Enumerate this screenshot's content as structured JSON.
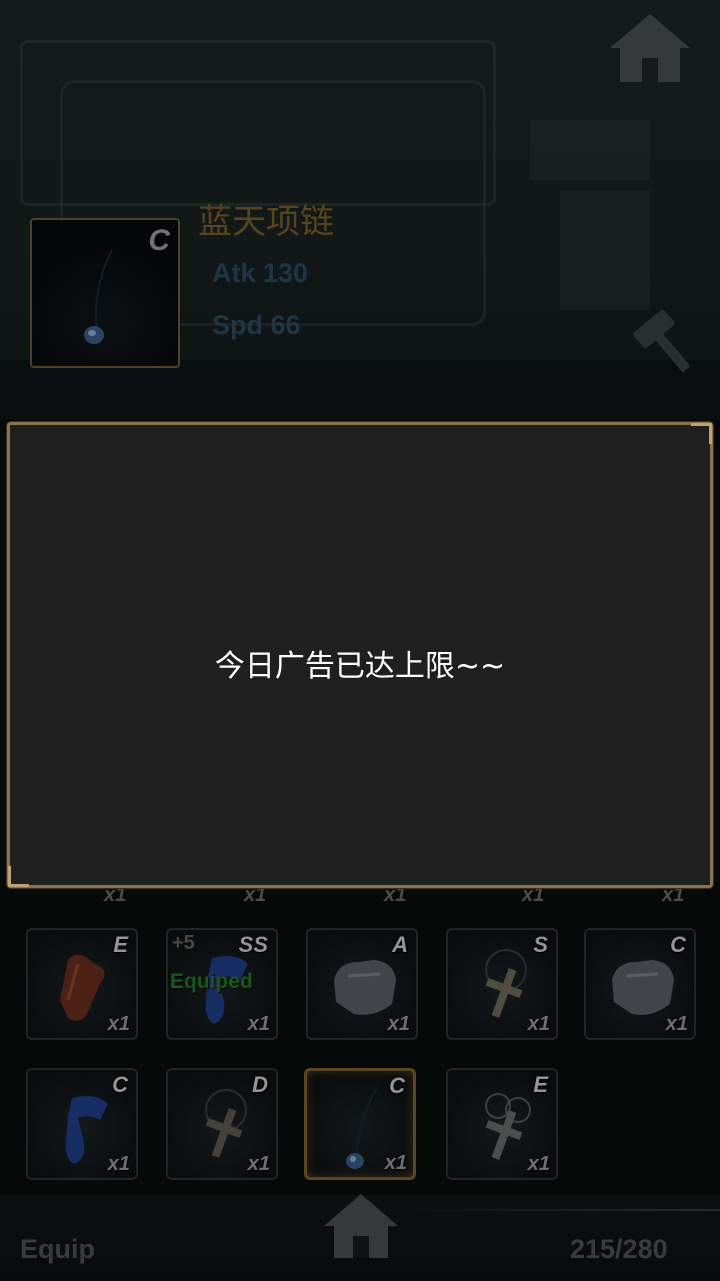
{
  "item_detail": {
    "name": "蓝天项链",
    "grade": "C",
    "stats": [
      "Atk 130",
      "Spd 66"
    ]
  },
  "dialog": {
    "message": "今日广告已达上限~~"
  },
  "partial_row_qty": [
    "x1",
    "x1",
    "x1",
    "x1",
    "x1"
  ],
  "inventory": [
    {
      "grade": "E",
      "qty": "x1",
      "plus": "",
      "equipped": "",
      "icon": "gloves-icon"
    },
    {
      "grade": "SS",
      "qty": "x1",
      "plus": "+5",
      "equipped": "Equiped",
      "icon": "blue-scarf-icon"
    },
    {
      "grade": "A",
      "qty": "x1",
      "plus": "",
      "equipped": "",
      "icon": "armor-icon"
    },
    {
      "grade": "S",
      "qty": "x1",
      "plus": "",
      "equipped": "",
      "icon": "cross-necklace-icon"
    },
    {
      "grade": "C",
      "qty": "x1",
      "plus": "",
      "equipped": "",
      "icon": "armor-icon"
    },
    {
      "grade": "C",
      "qty": "x1",
      "plus": "",
      "equipped": "",
      "icon": "blue-scarf-icon"
    },
    {
      "grade": "D",
      "qty": "x1",
      "plus": "",
      "equipped": "",
      "icon": "cross-necklace-icon"
    },
    {
      "grade": "C",
      "qty": "x1",
      "plus": "",
      "equipped": "",
      "icon": "blue-pendant-icon"
    },
    {
      "grade": "E",
      "qty": "x1",
      "plus": "",
      "equipped": "",
      "icon": "cross-necklace-icon"
    }
  ],
  "bottom_bar": {
    "tab_label": "Equip",
    "capacity": "215/280"
  },
  "colors": {
    "dialog_border": "#8a7450",
    "dialog_bg": "#1f1f1f",
    "item_name": "#7a5d2c",
    "stat_text": "#2c4a60",
    "equipped_text": "#1f7a2a"
  }
}
